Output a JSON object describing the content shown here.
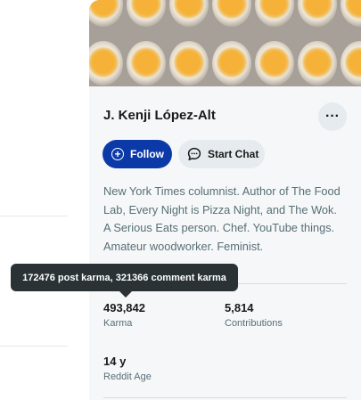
{
  "profile": {
    "name": "J. Kenji López-Alt",
    "more_label": "···",
    "follow_label": "Follow",
    "chat_label": "Start Chat",
    "bio": "New York Times columnist. Author of The Food Lab, Every Night is Pizza Night, and The Wok. A Serious Eats person. Chef. YouTube things. Amateur woodworker. Feminist."
  },
  "stats": {
    "karma": {
      "value": "493,842",
      "label": "Karma"
    },
    "contributions": {
      "value": "5,814",
      "label": "Contributions"
    },
    "age": {
      "value": "14 y",
      "label": "Reddit Age"
    }
  },
  "tooltip": {
    "text": "172476 post karma, 321366 comment karma"
  },
  "icons": {
    "more": "more-horizontal-icon",
    "follow": "plus-circle-icon",
    "chat": "chat-bubble-icon"
  },
  "colors": {
    "follow_button": "#0b3aa8",
    "secondary_button": "#e5ebee",
    "card_background": "#f6f7f8",
    "tooltip_background": "#2a3236"
  }
}
